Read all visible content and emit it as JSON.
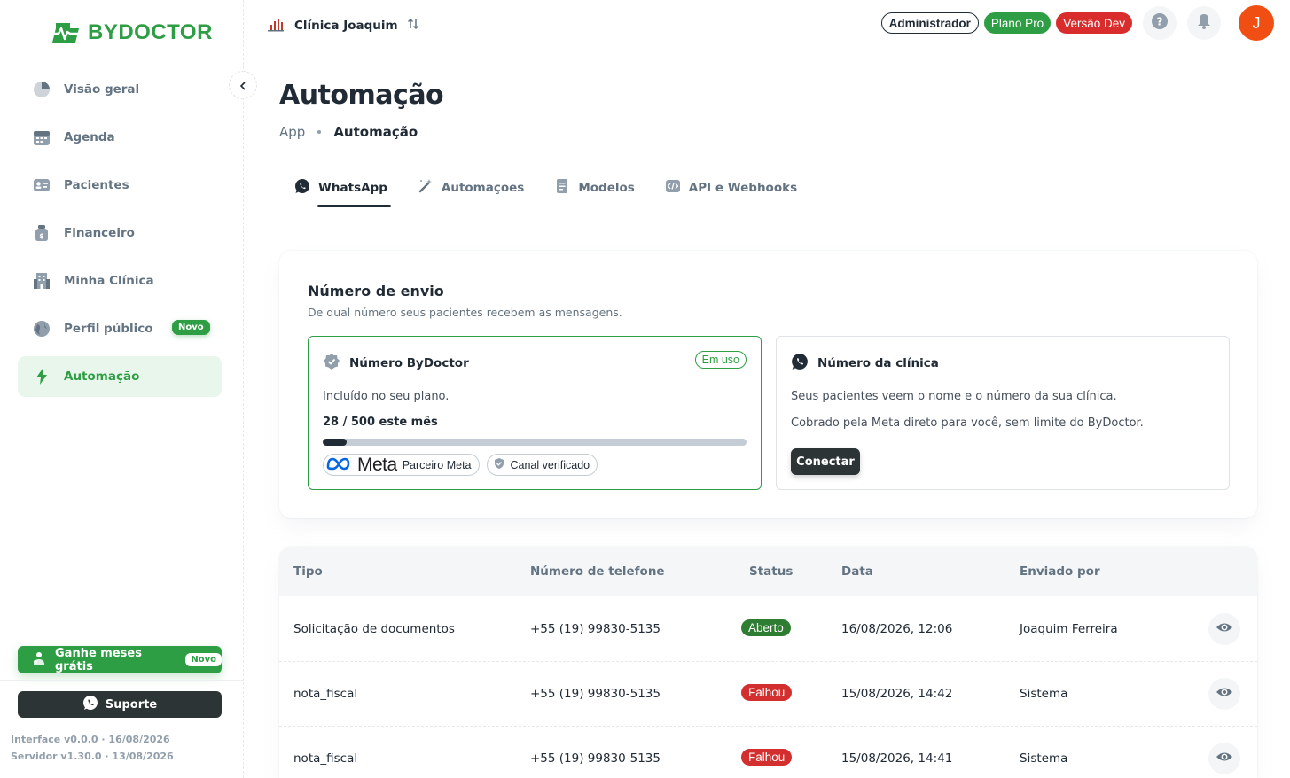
{
  "brand": {
    "name": "BYDOCTOR"
  },
  "sidebar": {
    "items": [
      {
        "label": "Visão geral",
        "icon": "pie-chart-icon"
      },
      {
        "label": "Agenda",
        "icon": "calendar-icon"
      },
      {
        "label": "Pacientes",
        "icon": "id-card-icon"
      },
      {
        "label": "Financeiro",
        "icon": "money-bag-icon"
      },
      {
        "label": "Minha Clínica",
        "icon": "building-icon"
      },
      {
        "label": "Perfil público",
        "icon": "globe-icon",
        "badge": "Novo"
      },
      {
        "label": "Automação",
        "icon": "lightning-icon",
        "active": true
      }
    ],
    "promo": {
      "label": "Ganhe meses grátis",
      "badge": "Novo"
    },
    "support": {
      "label": "Suporte"
    },
    "version_interface": "Interface v0.0.0 · 16/08/2026",
    "version_server": "Servidor v1.30.0 · 13/08/2026"
  },
  "topbar": {
    "clinic_name": "Clínica Joaquim",
    "role": "Administrador",
    "plan": "Plano Pro",
    "env": "Versão Dev",
    "avatar_initial": "J"
  },
  "page": {
    "title": "Automação",
    "breadcrumb": [
      "App",
      "Automação"
    ]
  },
  "tabs": [
    {
      "label": "WhatsApp",
      "icon": "whatsapp-icon",
      "active": true
    },
    {
      "label": "Automações",
      "icon": "magic-wand-icon"
    },
    {
      "label": "Modelos",
      "icon": "document-icon"
    },
    {
      "label": "API e Webhooks",
      "icon": "code-icon"
    }
  ],
  "sender": {
    "title": "Número de envio",
    "subtitle": "De qual número seus pacientes recebem as mensagens.",
    "bydoctor": {
      "title": "Número ByDoctor",
      "status": "Em uso",
      "included": "Incluído no seu plano.",
      "usage": "28 / 500 este mês",
      "usage_used": 28,
      "usage_limit": 500,
      "meta_word": "Meta",
      "meta_partner": "Parceiro Meta",
      "verified": "Canal verificado"
    },
    "clinic": {
      "title": "Número da clínica",
      "line1": "Seus pacientes veem o nome e o número da sua clínica.",
      "line2": "Cobrado pela Meta direto para você, sem limite do ByDoctor.",
      "connect": "Conectar"
    }
  },
  "table": {
    "headers": [
      "Tipo",
      "Número de telefone",
      "Status",
      "Data",
      "Enviado por"
    ],
    "rows": [
      {
        "tipo": "Solicitação de documentos",
        "telefone": "+55 (19) 99830-5135",
        "status": "Aberto",
        "status_color": "#2e7d32",
        "data": "16/08/2026, 12:06",
        "enviado_por": "Joaquim Ferreira"
      },
      {
        "tipo": "nota_fiscal",
        "telefone": "+55 (19) 99830-5135",
        "status": "Falhou",
        "status_color": "#d32f2f",
        "data": "15/08/2026, 14:42",
        "enviado_por": "Sistema"
      },
      {
        "tipo": "nota_fiscal",
        "telefone": "+55 (19) 99830-5135",
        "status": "Falhou",
        "status_color": "#d32f2f",
        "data": "15/08/2026, 14:41",
        "enviado_por": "Sistema"
      }
    ]
  },
  "colors": {
    "accent": "#2e9e44",
    "dark": "#2d3436",
    "danger": "#d92d2d",
    "avatar": "#f04e12"
  }
}
